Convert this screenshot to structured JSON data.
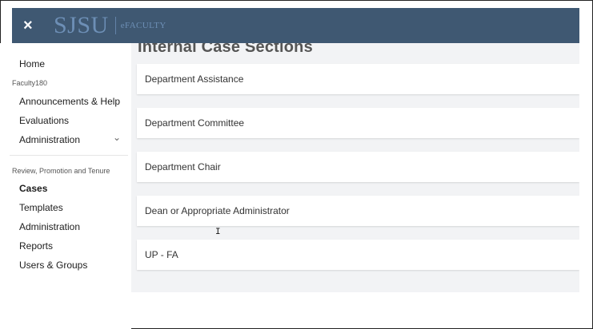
{
  "app": {
    "close_icon": "×",
    "logo_main": "SJSU",
    "logo_sub": "eFACULTY"
  },
  "sidebar": {
    "home": "Home",
    "section1": "Faculty180",
    "items1": [
      "Announcements & Help",
      "Evaluations",
      "Administration"
    ],
    "section2": "Review, Promotion and Tenure",
    "items2": [
      "Cases",
      "Templates",
      "Administration",
      "Reports",
      "Users & Groups"
    ],
    "chevron_icon": "chevron-down-icon"
  },
  "main": {
    "title": "Internal Case Sections",
    "sections": [
      "Department Assistance",
      "Department Committee",
      "Department Chair",
      "Dean or Appropriate Administrator",
      "UP - FA"
    ]
  },
  "cursor": "I"
}
